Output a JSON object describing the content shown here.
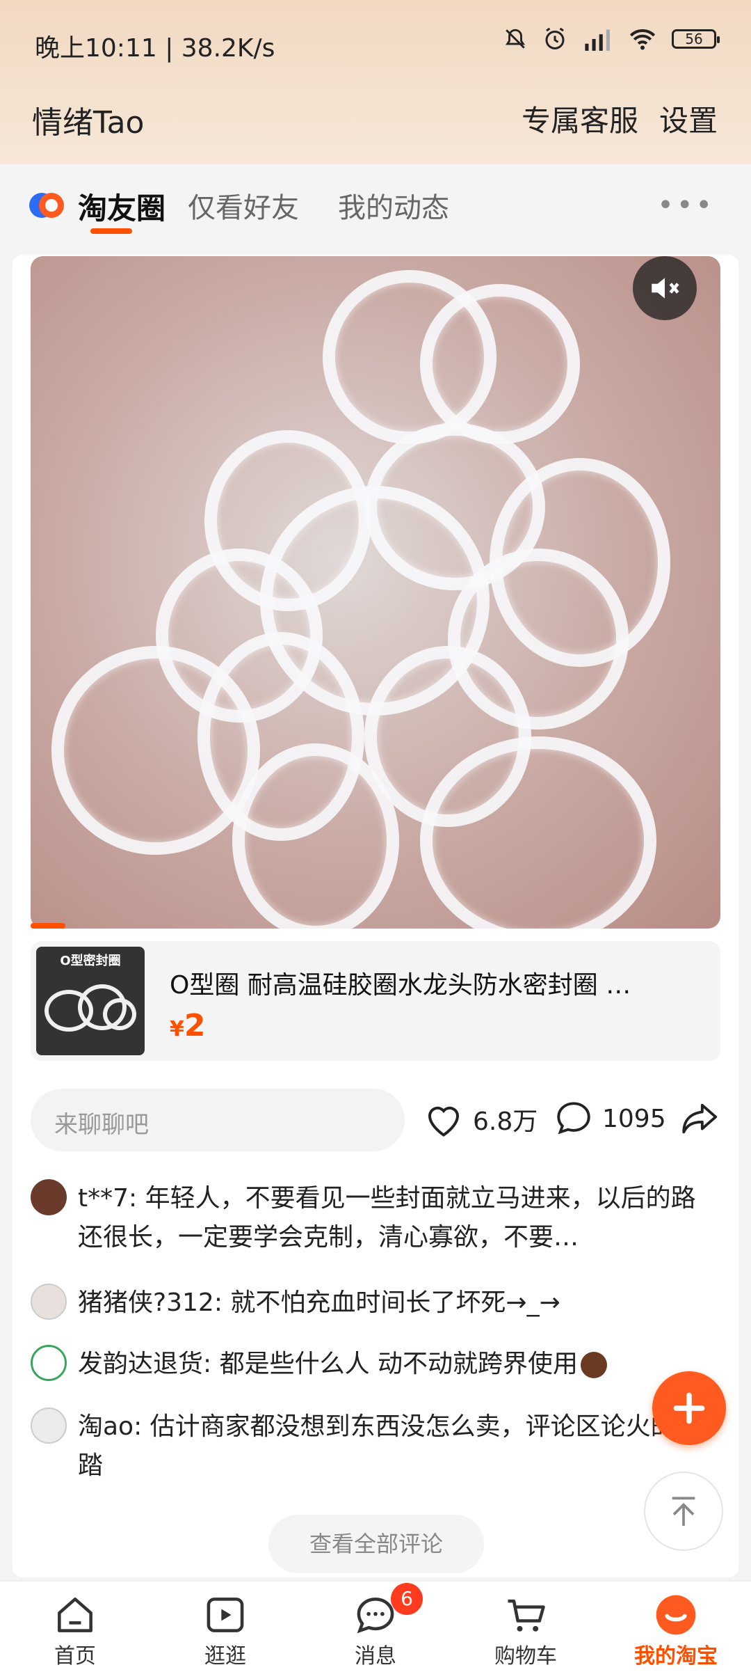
{
  "status_bar": {
    "time": "晚上10:11 | 38.2K/s",
    "battery": "56"
  },
  "header": {
    "title": "情绪Tao",
    "service_label": "专属客服",
    "settings_label": "设置"
  },
  "tabs": {
    "items": [
      "淘友圈",
      "仅看好友",
      "我的动态"
    ],
    "active": "淘友圈"
  },
  "product": {
    "thumb_label": "O型密封圈",
    "name": "O型圈 耐高温硅胶圈水龙头防水密封圈 …",
    "price_symbol": "¥",
    "price": "2"
  },
  "interactions": {
    "placeholder": "来聊聊吧",
    "likes": "6.8万",
    "comments": "1095"
  },
  "comments": [
    {
      "user": "t**7",
      "text": "年轻人，不要看见一些封面就立马进来，以后的路还很长，一定要学会克制，清心寡欲，不要…"
    },
    {
      "user": "猪猪侠?312",
      "text": "就不怕充血时间长了坏死→_→"
    },
    {
      "user": "发韵达退货",
      "text": "都是些什么人 动不动就跨界使用"
    },
    {
      "user": "淘ao",
      "text": "估计商家都没想到东西没怎么卖，评论区论火的一踏"
    }
  ],
  "view_all_label": "查看全部评论",
  "tabbar": {
    "items": [
      {
        "label": "首页",
        "icon": "home-icon"
      },
      {
        "label": "逛逛",
        "icon": "play-icon"
      },
      {
        "label": "消息",
        "icon": "message-icon",
        "badge": "6"
      },
      {
        "label": "购物车",
        "icon": "cart-icon"
      },
      {
        "label": "我的淘宝",
        "icon": "taobao-face-icon"
      }
    ],
    "active": "我的淘宝"
  },
  "colors": {
    "accent": "#ff5000",
    "header_bg": "#f1d9c2",
    "fab": "#ff5a1f"
  }
}
